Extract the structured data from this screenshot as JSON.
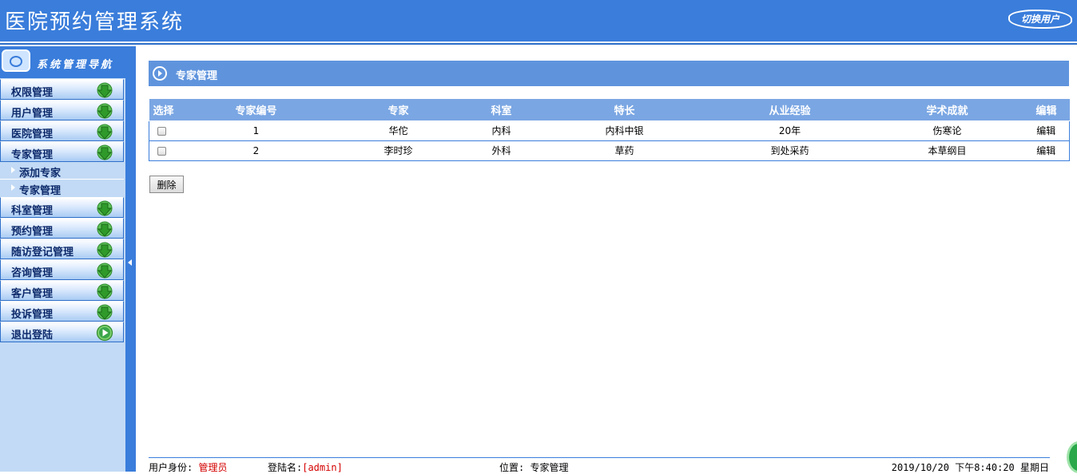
{
  "header": {
    "title": "医院预约管理系统",
    "switch_user": "切换用户"
  },
  "sidebar": {
    "nav_title": "系统管理导航",
    "items": [
      {
        "label": "权限管理",
        "icon": "green-down-arrow-icon"
      },
      {
        "label": "用户管理",
        "icon": "green-down-arrow-icon"
      },
      {
        "label": "医院管理",
        "icon": "green-down-arrow-icon"
      },
      {
        "label": "专家管理",
        "icon": "green-down-arrow-icon"
      },
      {
        "label": "科室管理",
        "icon": "green-down-arrow-icon"
      },
      {
        "label": "预约管理",
        "icon": "green-down-arrow-icon"
      },
      {
        "label": "随访登记管理",
        "icon": "green-down-arrow-icon"
      },
      {
        "label": "咨询管理",
        "icon": "green-down-arrow-icon"
      },
      {
        "label": "客户管理",
        "icon": "green-down-arrow-icon"
      },
      {
        "label": "投诉管理",
        "icon": "green-down-arrow-icon"
      },
      {
        "label": "退出登陆",
        "icon": "green-play-icon"
      }
    ],
    "subitems": [
      {
        "label": "添加专家"
      },
      {
        "label": "专家管理"
      }
    ]
  },
  "main": {
    "panel_title": "专家管理",
    "columns": [
      "选择",
      "专家编号",
      "专家",
      "科室",
      "特长",
      "从业经验",
      "学术成就",
      "编辑"
    ],
    "rows": [
      {
        "id": "1",
        "name": "华佗",
        "dept": "内科",
        "specialty": "内科中银",
        "experience": "20年",
        "achievement": "伤寒论",
        "edit": "编辑"
      },
      {
        "id": "2",
        "name": "李时珍",
        "dept": "外科",
        "specialty": "草药",
        "experience": "到处采药",
        "achievement": "本草纲目",
        "edit": "编辑"
      }
    ],
    "delete_button": "删除"
  },
  "footer": {
    "identity_label": "用户身份:",
    "identity_value": "管理员",
    "login_label": "登陆名:",
    "login_value": "[admin]",
    "location_label": "位置:",
    "location_value": "专家管理",
    "datetime": "2019/10/20 下午8:40:20 星期日"
  },
  "colors": {
    "header_blue": "#3a7ddb",
    "sidebar_bg": "#c2daf5",
    "table_header": "#7aa6e3",
    "panel_title": "#5f94dd",
    "accent_red": "#d40000"
  }
}
